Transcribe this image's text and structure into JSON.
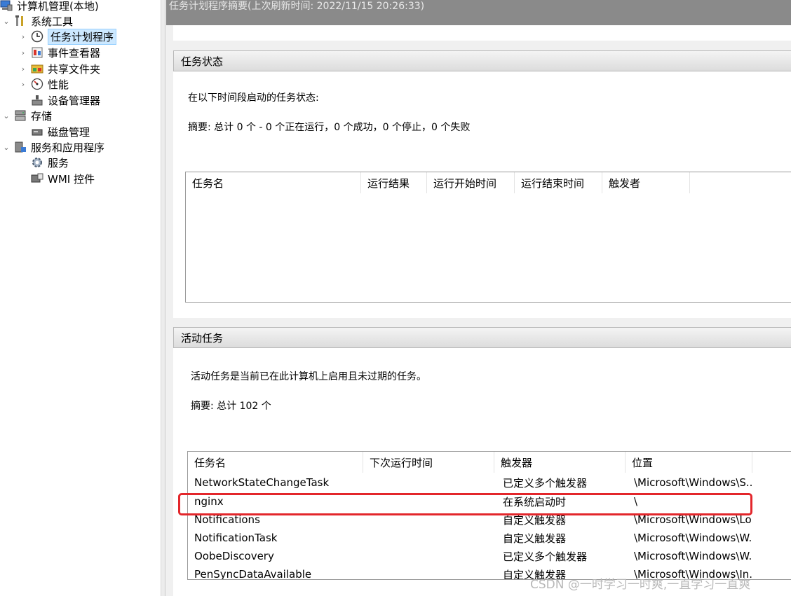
{
  "tree": {
    "root": "计算机管理(本地)",
    "system_tools": "系统工具",
    "task_scheduler": "任务计划程序",
    "event_viewer": "事件查看器",
    "shared_folders": "共享文件夹",
    "performance": "性能",
    "device_manager": "设备管理器",
    "storage": "存储",
    "disk_management": "磁盘管理",
    "services_apps": "服务和应用程序",
    "services": "服务",
    "wmi": "WMI 控件"
  },
  "header": {
    "title": "任务计划程序摘要(上次刷新时间: 2022/11/15 20:26:33)"
  },
  "task_status": {
    "title": "任务状态",
    "period_label": "在以下时间段启动的任务状态:",
    "summary": "摘要: 总计 0 个 - 0 个正在运行，0 个成功，0 个停止，0 个失败",
    "columns": [
      "任务名",
      "运行结果",
      "运行开始时间",
      "运行结束时间",
      "触发者"
    ]
  },
  "active_tasks": {
    "title": "活动任务",
    "description": "活动任务是当前已在此计算机上启用且未过期的任务。",
    "summary": "摘要: 总计 102 个",
    "columns": [
      "任务名",
      "下次运行时间",
      "触发器",
      "位置"
    ],
    "rows": [
      {
        "name": "NetworkStateChangeTask",
        "next_run": "",
        "trigger": "已定义多个触发器",
        "location": "\\Microsoft\\Windows\\S..."
      },
      {
        "name": "nginx",
        "next_run": "",
        "trigger": "在系统启动时",
        "location": "\\"
      },
      {
        "name": "Notifications",
        "next_run": "",
        "trigger": "自定义触发器",
        "location": "\\Microsoft\\Windows\\Lo..."
      },
      {
        "name": "NotificationTask",
        "next_run": "",
        "trigger": "自定义触发器",
        "location": "\\Microsoft\\Windows\\W..."
      },
      {
        "name": "OobeDiscovery",
        "next_run": "",
        "trigger": "已定义多个触发器",
        "location": "\\Microsoft\\Windows\\W..."
      },
      {
        "name": "PenSyncDataAvailable",
        "next_run": "",
        "trigger": "自定义触发器",
        "location": "\\Microsoft\\Windows\\In..."
      }
    ]
  },
  "watermark": "CSDN @一时学习一时爽,一直学习一直爽",
  "colors": {
    "title_bar": "#8a8a8a",
    "selection": "#cce8ff",
    "highlight_box": "#e3262b"
  }
}
